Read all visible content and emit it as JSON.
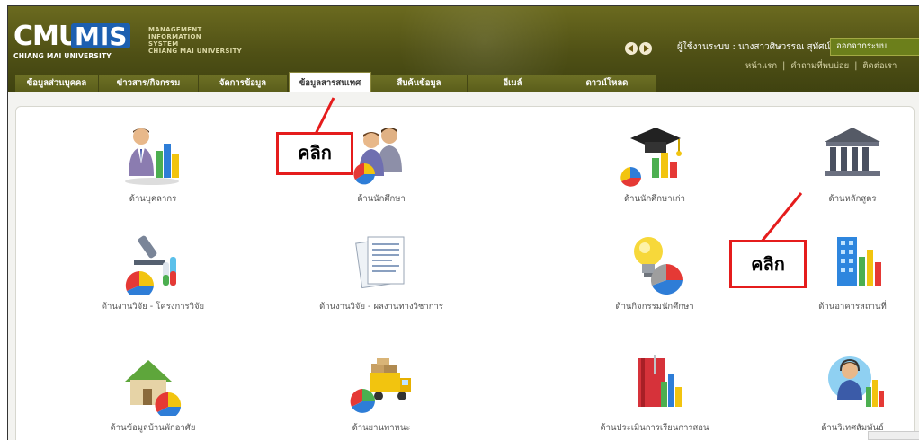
{
  "header": {
    "logo_main": "CMU",
    "logo_badge": "MIS",
    "logo_sub": "CHIANG MAI UNIVERSITY",
    "system_lines": [
      "MANAGEMENT",
      "INFORMATION",
      "SYSTEM",
      "CHIANG MAI UNIVERSITY"
    ],
    "user_text": "ผู้ใช้งานระบบ : นางสาวศิษวรรณ สุทัศน์สันติ",
    "logout_label": "ออกจากระบบ",
    "links": [
      "หน้าแรก",
      "คำถามที่พบบ่อย",
      "ติดต่อเรา"
    ]
  },
  "tabs": [
    {
      "label": "ข้อมูลส่วนบุคคล",
      "active": false
    },
    {
      "label": "ข่าวสาร/กิจกรรม",
      "active": false
    },
    {
      "label": "จัดการข้อมูล",
      "active": false
    },
    {
      "label": "ข้อมูลสารสนเทศ",
      "active": true
    },
    {
      "label": "สืบค้นข้อมูล",
      "active": false
    },
    {
      "label": "อีเมล์",
      "active": false
    },
    {
      "label": "ดาวน์โหลด",
      "active": false
    }
  ],
  "items": [
    {
      "label": "ด้านบุคลากร",
      "icon": "personnel-chart-icon"
    },
    {
      "label": "ด้านนักศึกษา",
      "icon": "students-pie-icon"
    },
    {
      "label": "ด้านนักศึกษาเก่า",
      "icon": "alumni-graduation-icon"
    },
    {
      "label": "ด้านหลักสูตร",
      "icon": "curriculum-building-icon"
    },
    {
      "label": "ด้านงานวิจัย - โครงการวิจัย",
      "icon": "research-microscope-icon"
    },
    {
      "label": "ด้านงานวิจัย - ผลงานทางวิชาการ",
      "icon": "academic-documents-icon"
    },
    {
      "label": "ด้านกิจกรรมนักศึกษา",
      "icon": "activity-lightbulb-icon"
    },
    {
      "label": "ด้านอาคารสถานที่",
      "icon": "buildings-icon"
    },
    {
      "label": "ด้านข้อมูลบ้านพักอาศัย",
      "icon": "housing-icon"
    },
    {
      "label": "ด้านยานพาหนะ",
      "icon": "vehicle-truck-icon"
    },
    {
      "label": "ด้านประเมินการเรียนการสอน",
      "icon": "teaching-evaluation-icon"
    },
    {
      "label": "ด้านวิเทศสัมพันธ์",
      "icon": "international-relations-icon"
    }
  ],
  "callouts": [
    "คลิก",
    "คลิก"
  ],
  "colors": {
    "header": "#5a5c1a",
    "logo_badge": "#1c5fb0",
    "callout_border": "#e51c1c"
  }
}
